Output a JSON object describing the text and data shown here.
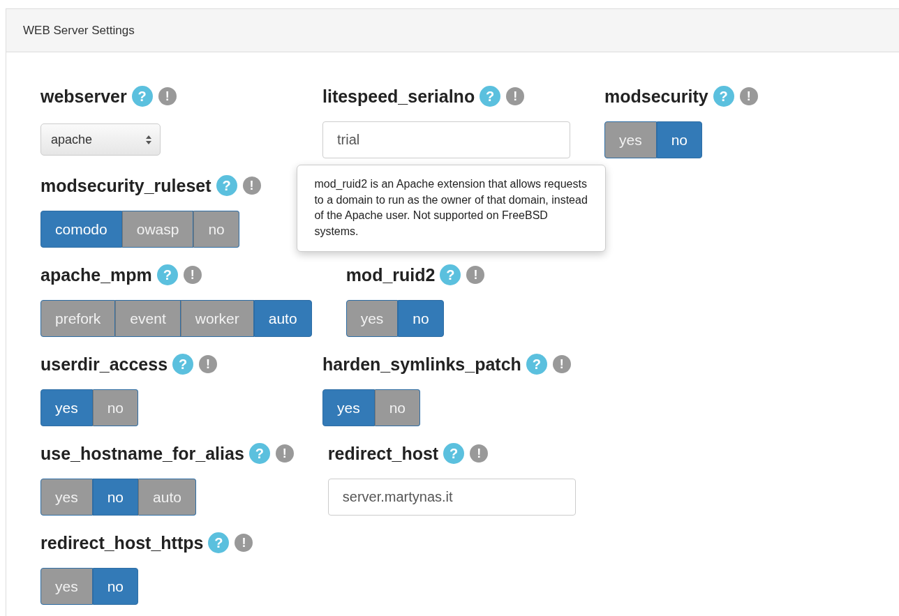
{
  "panel": {
    "title": "WEB Server Settings"
  },
  "rows": [
    {
      "settings": [
        {
          "name": "webserver",
          "help_icon": "?",
          "info_icon": "!",
          "kind": "select",
          "value": "apache"
        },
        {
          "name": "litespeed_serialno",
          "help_icon": "?",
          "info_icon": "!",
          "kind": "text",
          "value": "trial"
        },
        {
          "name": "modsecurity",
          "help_icon": "?",
          "info_icon": "!",
          "kind": "buttons",
          "options": [
            {
              "label": "yes",
              "selected": false
            },
            {
              "label": "no",
              "selected": true
            }
          ]
        }
      ]
    },
    {
      "settings": [
        {
          "name": "modsecurity_ruleset",
          "help_icon": "?",
          "info_icon": "!",
          "kind": "buttons",
          "options": [
            {
              "label": "comodo",
              "selected": true
            },
            {
              "label": "owasp",
              "selected": false
            },
            {
              "label": "no",
              "selected": false
            }
          ]
        }
      ]
    },
    {
      "settings": [
        {
          "name": "apache_mpm",
          "help_icon": "?",
          "info_icon": "!",
          "kind": "buttons",
          "options": [
            {
              "label": "prefork",
              "selected": false
            },
            {
              "label": "event",
              "selected": false
            },
            {
              "label": "worker",
              "selected": false
            },
            {
              "label": "auto",
              "selected": true
            }
          ]
        },
        {
          "name": "mod_ruid2",
          "help_icon": "?",
          "info_icon": "!",
          "kind": "buttons",
          "tooltip": "mod_ruid2 is an Apache extension that allows requests to a domain to run as the owner of that domain, instead of the Apache user. Not supported on FreeBSD systems.",
          "options": [
            {
              "label": "yes",
              "selected": false
            },
            {
              "label": "no",
              "selected": true
            }
          ]
        }
      ]
    },
    {
      "settings": [
        {
          "name": "userdir_access",
          "help_icon": "?",
          "info_icon": "!",
          "kind": "buttons",
          "options": [
            {
              "label": "yes",
              "selected": true
            },
            {
              "label": "no",
              "selected": false
            }
          ]
        },
        {
          "name": "harden_symlinks_patch",
          "help_icon": "?",
          "info_icon": "!",
          "kind": "buttons",
          "options": [
            {
              "label": "yes",
              "selected": true
            },
            {
              "label": "no",
              "selected": false
            }
          ]
        }
      ]
    },
    {
      "settings": [
        {
          "name": "use_hostname_for_alias",
          "help_icon": "?",
          "info_icon": "!",
          "kind": "buttons",
          "options": [
            {
              "label": "yes",
              "selected": false
            },
            {
              "label": "no",
              "selected": true
            },
            {
              "label": "auto",
              "selected": false
            }
          ]
        },
        {
          "name": "redirect_host",
          "help_icon": "?",
          "info_icon": "!",
          "kind": "text",
          "value": "server.martynas.it"
        }
      ]
    },
    {
      "settings": [
        {
          "name": "redirect_host_https",
          "help_icon": "?",
          "info_icon": "!",
          "kind": "buttons",
          "options": [
            {
              "label": "yes",
              "selected": false
            },
            {
              "label": "no",
              "selected": true
            }
          ]
        }
      ]
    }
  ]
}
